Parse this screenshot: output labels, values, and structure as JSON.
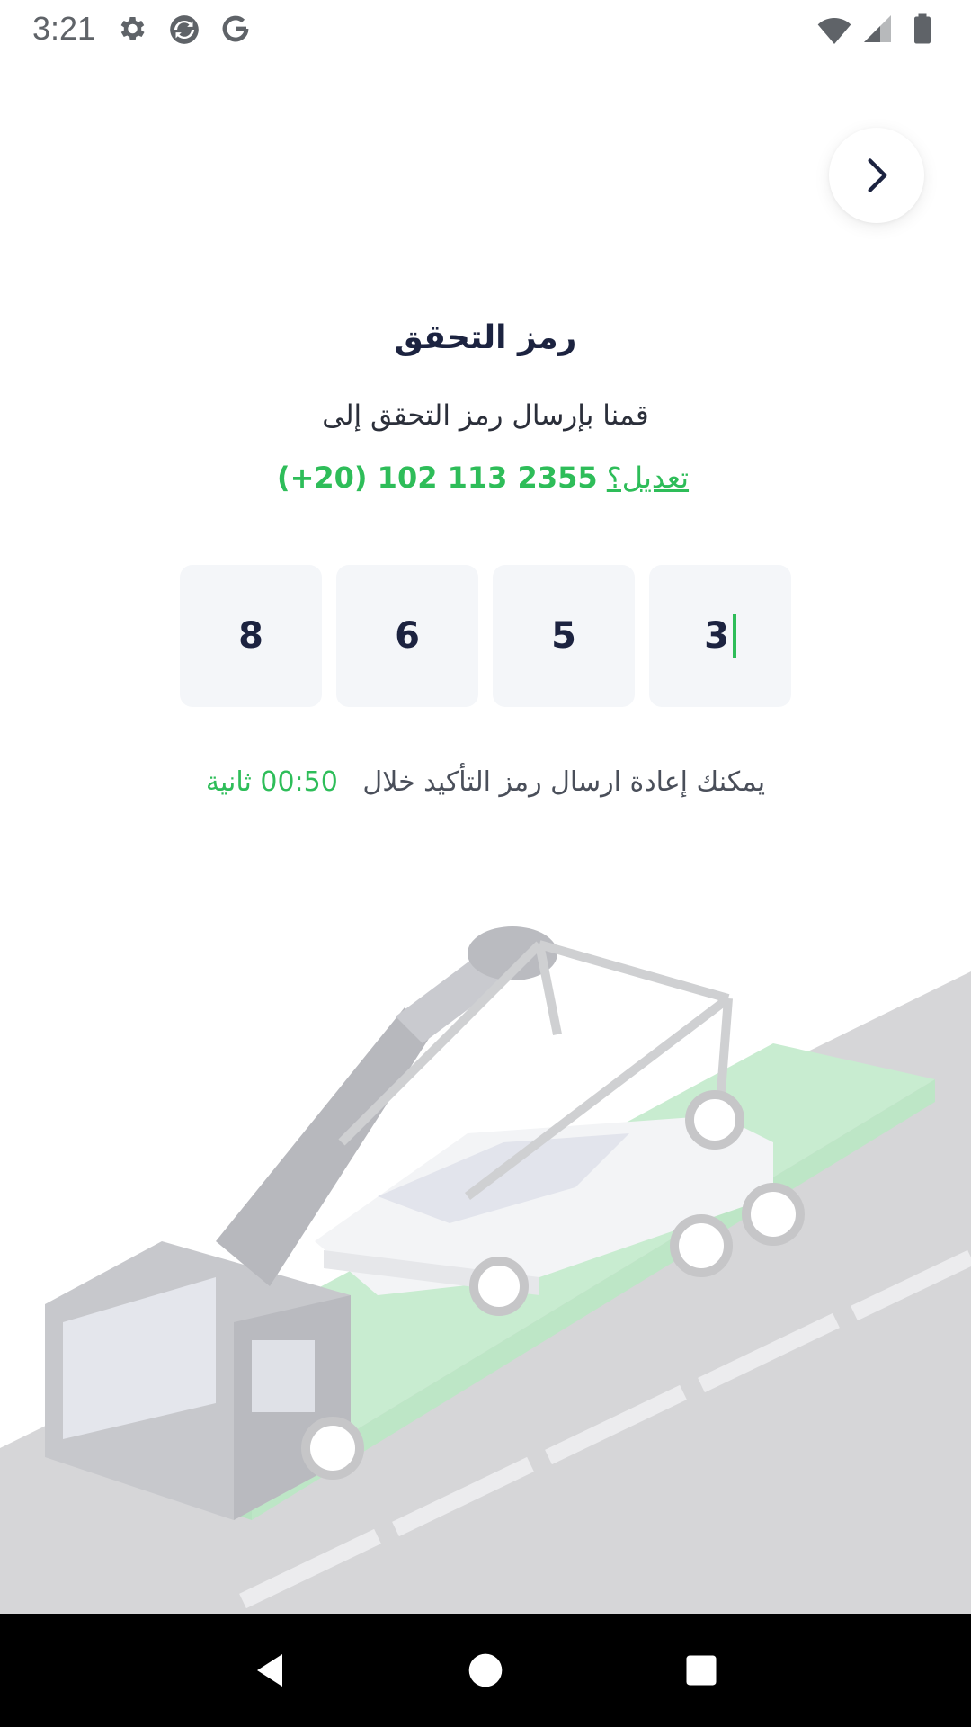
{
  "status_bar": {
    "time": "3:21",
    "left_icons": [
      "settings-icon",
      "sync-icon",
      "google-icon"
    ],
    "right_icons": [
      "wifi-icon",
      "signal-icon",
      "battery-icon"
    ]
  },
  "header": {
    "nav_button_icon": "chevron-right-icon"
  },
  "verification": {
    "title": "رمز التحقق",
    "subtitle": "قمنا بإرسال رمز التحقق إلى",
    "phone": "(+20) 102 113 2355",
    "edit_label": "تعديل؟",
    "otp_digits": [
      "8",
      "6",
      "5",
      "3"
    ],
    "resend_text": "يمكنك إعادة ارسال رمز التأكيد خلال",
    "timer": "00:50 ثانية"
  },
  "colors": {
    "accent": "#2ebd59",
    "title": "#1c2340",
    "otp_bg": "#f4f6f9"
  },
  "illustration": {
    "icon": "tow-truck-illustration"
  },
  "nav_bar": {
    "buttons": [
      "back-icon",
      "home-icon",
      "recents-icon"
    ]
  }
}
